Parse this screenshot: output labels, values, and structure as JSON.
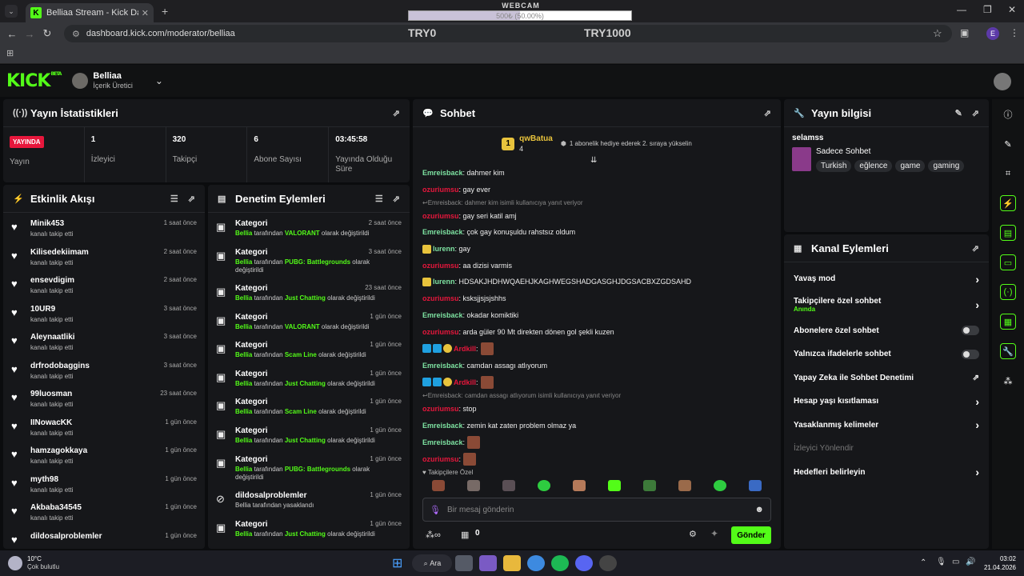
{
  "browser": {
    "tab_title": "Belliaa Stream - Kick Dashboard",
    "url": "dashboard.kick.com/moderator/belliaa",
    "profile_initial": "E"
  },
  "overlay": {
    "label": "WEBCAM",
    "progress_text": "500₺ (50.00%)",
    "progress_fraction": 0.5,
    "left_label": "TRY0",
    "right_label": "TRY1000"
  },
  "header": {
    "logo": "KICK",
    "logo_beta": "BETA",
    "channel_name": "Belliaa",
    "channel_role": "İçerik Üretici"
  },
  "stats_panel": {
    "title": "Yayın İstatistikleri",
    "live_badge": "YAYINDA",
    "items": [
      {
        "value": "",
        "label": "Yayın"
      },
      {
        "value": "1",
        "label": "İzleyici"
      },
      {
        "value": "320",
        "label": "Takipçi"
      },
      {
        "value": "6",
        "label": "Abone Sayısı"
      },
      {
        "value": "03:45:58",
        "label": "Yayında Olduğu Süre"
      }
    ]
  },
  "activity": {
    "title": "Etkinlik Akışı",
    "items": [
      {
        "name": "Minik453",
        "desc": "kanalı takip etti",
        "time": "1 saat önce"
      },
      {
        "name": "Kilisedekiimam",
        "desc": "kanalı takip etti",
        "time": "2 saat önce"
      },
      {
        "name": "ensevdigim",
        "desc": "kanalı takip etti",
        "time": "2 saat önce"
      },
      {
        "name": "10UR9",
        "desc": "kanalı takip etti",
        "time": "3 saat önce"
      },
      {
        "name": "Aleynaatliki",
        "desc": "kanalı takip etti",
        "time": "3 saat önce"
      },
      {
        "name": "drfrodobaggins",
        "desc": "kanalı takip etti",
        "time": "3 saat önce"
      },
      {
        "name": "99luosman",
        "desc": "kanalı takip etti",
        "time": "23 saat önce"
      },
      {
        "name": "IINowacKK",
        "desc": "kanalı takip etti",
        "time": "1 gün önce"
      },
      {
        "name": "hamzagokkaya",
        "desc": "kanalı takip etti",
        "time": "1 gün önce"
      },
      {
        "name": "myth98",
        "desc": "kanalı takip etti",
        "time": "1 gün önce"
      },
      {
        "name": "Akbaba34545",
        "desc": "kanalı takip etti",
        "time": "1 gün önce"
      },
      {
        "name": "dildosalproblemler",
        "desc": "",
        "time": "1 gün önce"
      }
    ]
  },
  "moderation": {
    "title": "Denetim Eylemleri",
    "by_word": "Bellia",
    "mid_text": " tarafından ",
    "end_text": " olarak değiştirildi",
    "items": [
      {
        "title": "Kategori",
        "category": "VALORANT",
        "time": "2 saat önce"
      },
      {
        "title": "Kategori",
        "category": "PUBG: Battlegrounds",
        "time": "3 saat önce"
      },
      {
        "title": "Kategori",
        "category": "Just Chatting",
        "time": "23 saat önce"
      },
      {
        "title": "Kategori",
        "category": "VALORANT",
        "time": "1 gün önce"
      },
      {
        "title": "Kategori",
        "category": "Scam Line",
        "time": "1 gün önce"
      },
      {
        "title": "Kategori",
        "category": "Just Chatting",
        "time": "1 gün önce"
      },
      {
        "title": "Kategori",
        "category": "Scam Line",
        "time": "1 gün önce"
      },
      {
        "title": "Kategori",
        "category": "Just Chatting",
        "time": "1 gün önce"
      },
      {
        "title": "Kategori",
        "category": "PUBG: Battlegrounds",
        "time": "1 gün önce"
      },
      {
        "title": "dildosalproblemler",
        "ban_text": "Bellia tarafından yasaklandı",
        "time": "1 gün önce"
      },
      {
        "title": "Kategori",
        "category": "Just Chatting",
        "time": "1 gün önce"
      }
    ]
  },
  "chat": {
    "title": "Sohbet",
    "pinned_user": "qwBatua",
    "pinned_count": "4",
    "pinned_rank": "1",
    "pinned_text": "1 abonelik hediye ederek 2. sıraya yükselin",
    "messages": [
      {
        "user": "Emreisback",
        "color": "#7ee3a2",
        "text": ": dahmer kim"
      },
      {
        "user": "ozuriumsu",
        "color": "#e7173c",
        "text": ": gay ever"
      },
      {
        "reply": "Emreisback: dahmer kim isimli kullanıcıya yanıt veriyor"
      },
      {
        "user": "ozuriumsu",
        "color": "#e7173c",
        "text": ": gay seri katil amj"
      },
      {
        "user": "Emreisback",
        "color": "#7ee3a2",
        "text": ": çok gay konuşuldu rahstsız oldum"
      },
      {
        "user": "lurenn",
        "color": "#7ee3a2",
        "text": ": gay",
        "crown": true
      },
      {
        "user": "ozuriumsu",
        "color": "#e7173c",
        "text": ": aa dizisi varmis"
      },
      {
        "user": "lurenn",
        "color": "#7ee3a2",
        "text": ": HDSAKJHDHWQAEHJKAGHWEGSHADGASGHJDGSACBXZGDSAHD",
        "crown": true
      },
      {
        "user": "ozuriumsu",
        "color": "#e7173c",
        "text": ": ksksjjsjsjshhs"
      },
      {
        "user": "Emreisback",
        "color": "#7ee3a2",
        "text": ": okadar komiktiki"
      },
      {
        "user": "ozuriumsu",
        "color": "#e7173c",
        "text": ": arda güler 90 Mt direkten dönen gol şekli kuzen"
      },
      {
        "user": "Ardkill",
        "color": "#e7173c",
        "text": ":",
        "badges": true,
        "emote": true
      },
      {
        "user": "Emreisback",
        "color": "#7ee3a2",
        "text": ": camdan assagı atlıyorum"
      },
      {
        "user": "Ardkill",
        "color": "#e7173c",
        "text": ":",
        "badges": true,
        "emote": true
      },
      {
        "reply": "Emreisback: camdan assagı atlıyorum isimli kullanıcıya yanıt veriyor"
      },
      {
        "user": "ozuriumsu",
        "color": "#e7173c",
        "text": ": stop"
      },
      {
        "user": "Emreisback",
        "color": "#7ee3a2",
        "text": ": zemin kat zaten problem olmaz ya"
      },
      {
        "user": "Emreisback",
        "color": "#7ee3a2",
        "text": ":",
        "emote": true
      },
      {
        "user": "ozuriumsu",
        "color": "#e7173c",
        "text": ":",
        "emote": true
      }
    ],
    "followers_label": "Takipçilere Özel",
    "input_placeholder": "Bir mesaj gönderin",
    "bottom_count": "0",
    "send_label": "Gönder"
  },
  "stream_info": {
    "title": "Yayın bilgisi",
    "stream_title": "selamss",
    "mode": "Sadece Sohbet",
    "tags": [
      "Turkish",
      "eğlence",
      "game",
      "gaming"
    ]
  },
  "channel_actions": {
    "title": "Kanal Eylemleri",
    "items": [
      {
        "label": "Yavaş mod",
        "kind": "chevron"
      },
      {
        "label": "Takipçilere özel sohbet",
        "sub": "Anında",
        "kind": "chevron"
      },
      {
        "label": "Abonelere özel sohbet",
        "kind": "toggle"
      },
      {
        "label": "Yalnızca ifadelerle sohbet",
        "kind": "toggle"
      },
      {
        "label": "Yapay Zeka ile Sohbet Denetimi",
        "kind": "external"
      },
      {
        "label": "Hesap yaşı kısıtlaması",
        "kind": "chevron"
      },
      {
        "label": "Yasaklanmış kelimeler",
        "kind": "chevron"
      },
      {
        "label": "İzleyici Yönlendir",
        "kind": "disabled"
      },
      {
        "label": "Hedefleri belirleyin",
        "kind": "chevron"
      }
    ]
  },
  "taskbar": {
    "weather_temp": "10°C",
    "weather_desc": "Çok bulutlu",
    "search_label": "Ara",
    "time": "03:02",
    "date": "21.04.2026"
  },
  "colors": {
    "accent": "#53fc18",
    "live": "#e7173c",
    "bg": "#0b0c0e",
    "panel": "#16171a"
  }
}
